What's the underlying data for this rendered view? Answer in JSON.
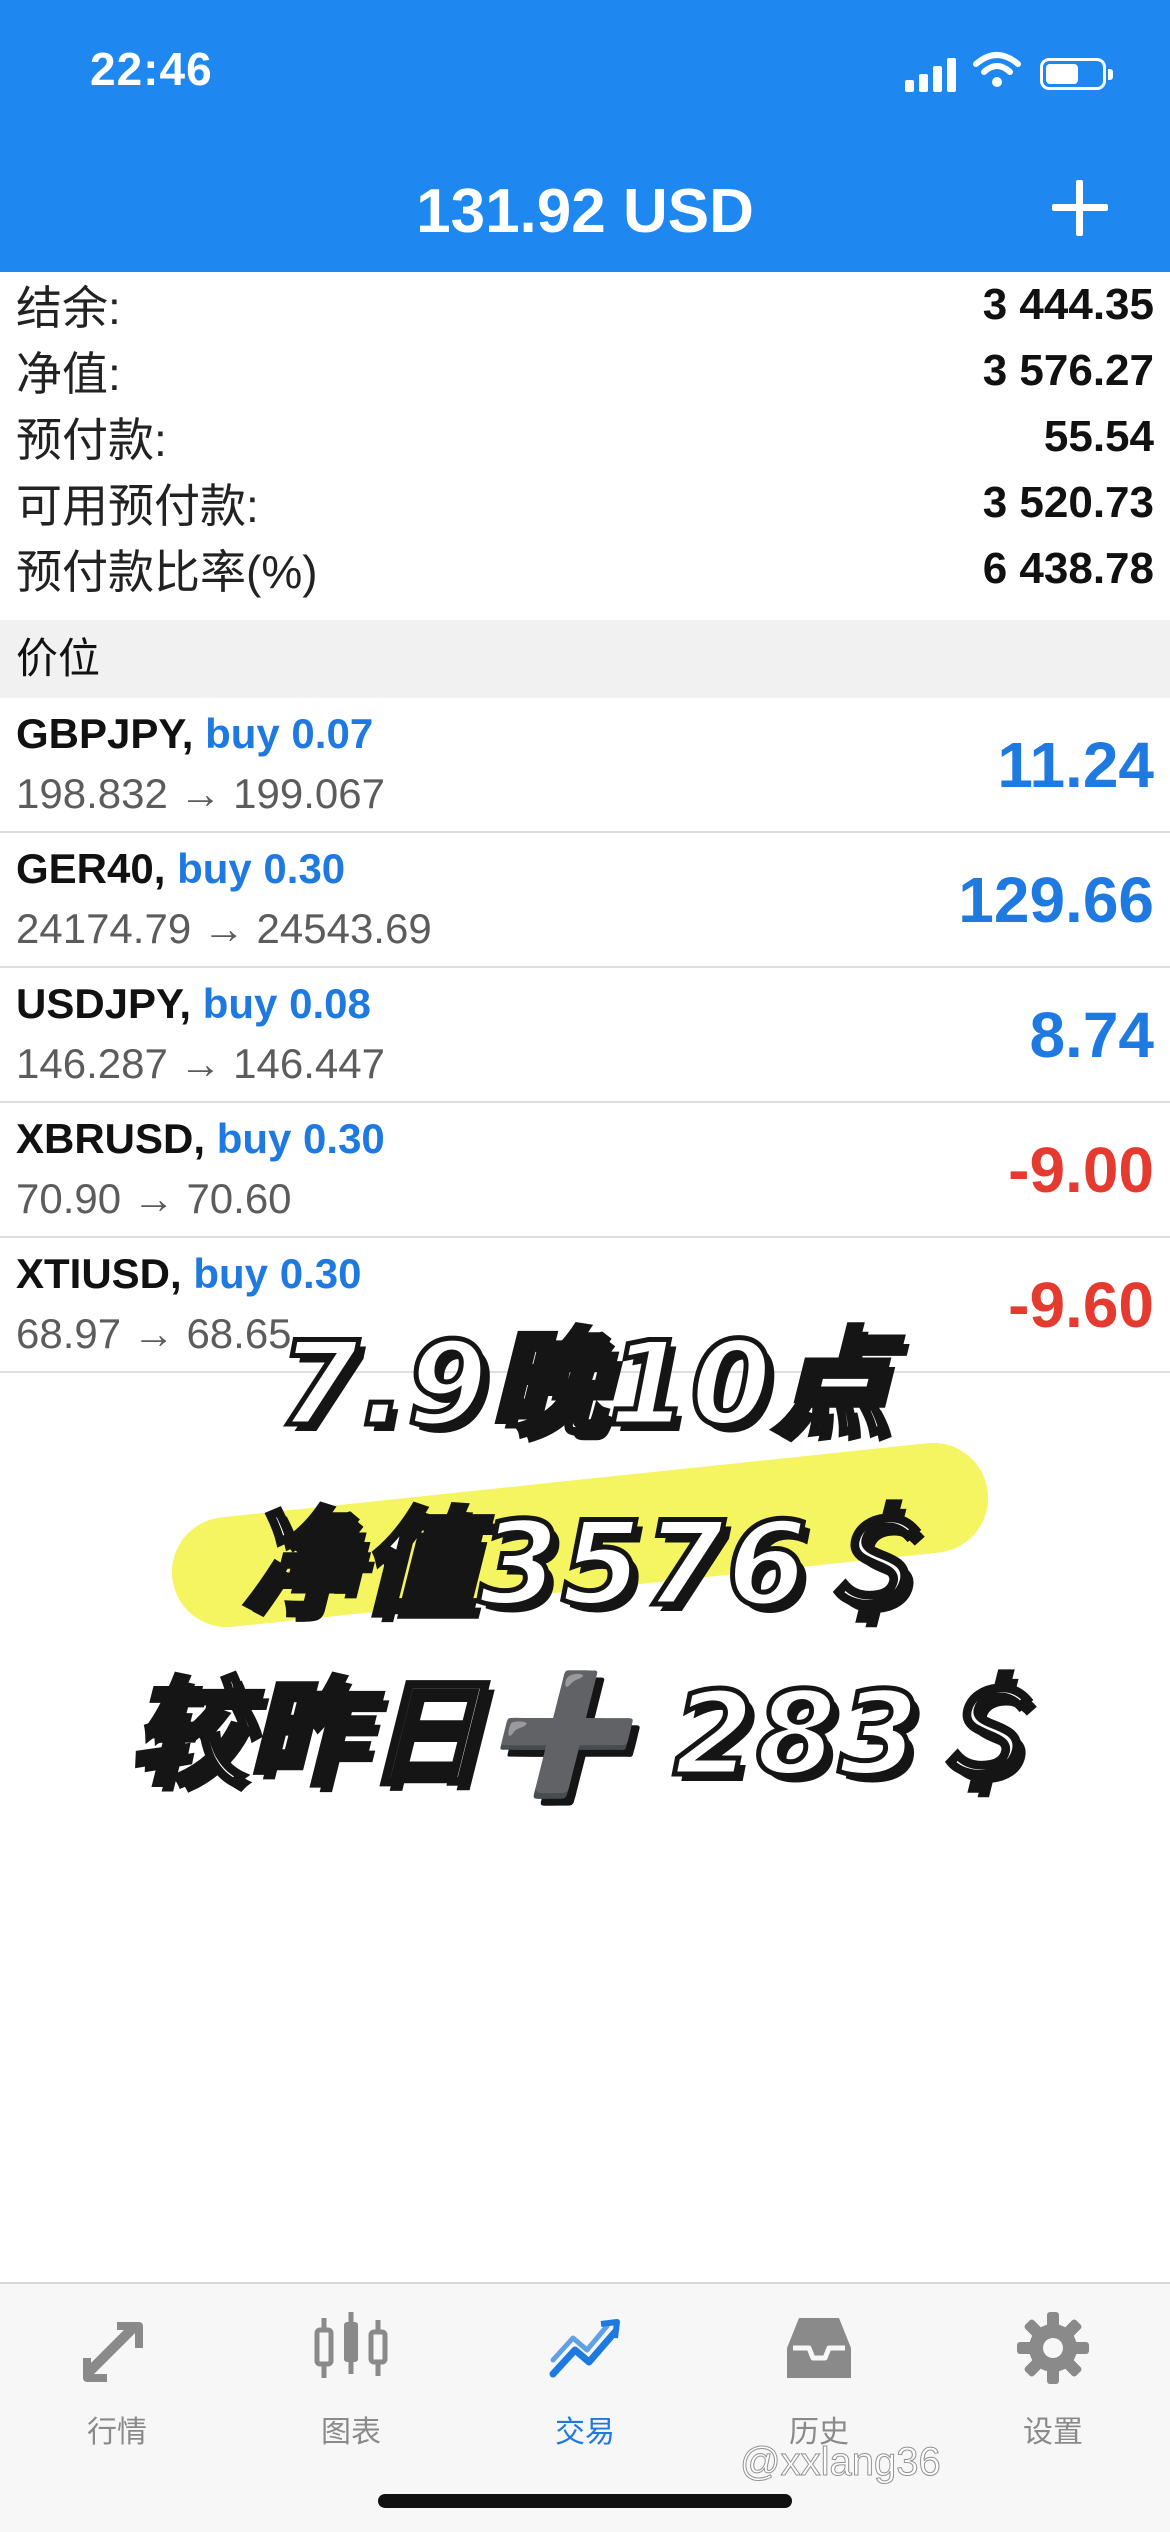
{
  "status_bar": {
    "time": "22:46"
  },
  "nav": {
    "title": "131.92 USD",
    "add_icon": "plus-icon"
  },
  "account": [
    {
      "label": "结余:",
      "value": "3 444.35"
    },
    {
      "label": "净值:",
      "value": "3 576.27"
    },
    {
      "label": "预付款:",
      "value": "55.54"
    },
    {
      "label": "可用预付款:",
      "value": "3 520.73"
    },
    {
      "label": "预付款比率(%)",
      "value": "6 438.78"
    }
  ],
  "section_header": "价位",
  "positions": [
    {
      "symbol": "GBPJPY,",
      "side": "buy 0.07",
      "prices": "198.832 → 199.067",
      "profit": "11.24"
    },
    {
      "symbol": "GER40,",
      "side": "buy 0.30",
      "prices": "24174.79 → 24543.69",
      "profit": "129.66"
    },
    {
      "symbol": "USDJPY,",
      "side": "buy 0.08",
      "prices": "146.287 → 146.447",
      "profit": "8.74"
    },
    {
      "symbol": "XBRUSD,",
      "side": "buy 0.30",
      "prices": "70.90 → 70.60",
      "profit": "-9.00"
    },
    {
      "symbol": "XTIUSD,",
      "side": "buy 0.30",
      "prices": "68.97 → 68.65",
      "profit": "-9.60"
    }
  ],
  "overlay": {
    "line1": "7.9晚10点",
    "line2": "净值3576＄",
    "line3": "较昨日➕ 283＄"
  },
  "tabs": [
    {
      "label": "行情",
      "icon": "quotes-arrows-icon"
    },
    {
      "label": "图表",
      "icon": "candlestick-chart-icon"
    },
    {
      "label": "交易",
      "icon": "trade-trend-icon"
    },
    {
      "label": "历史",
      "icon": "history-inbox-icon"
    },
    {
      "label": "设置",
      "icon": "gear-icon"
    }
  ],
  "watermark": "@xxlang36",
  "colors": {
    "accent": "#1e88f0",
    "profit_positive": "#1e7ae0",
    "profit_negative": "#e53a2f",
    "highlight": "#f3f245"
  }
}
